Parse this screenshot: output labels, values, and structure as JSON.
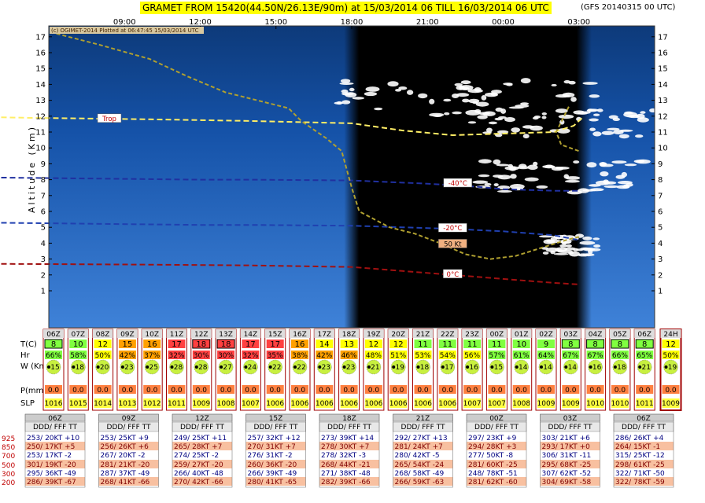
{
  "header": {
    "title": "GRAMET FROM 15420(44.50N/26.13E/90m) at 15/03/2014 06   TILL  16/03/2014 06 UTC",
    "model": "(GFS 20140315 00 UTC)",
    "credit": "(c) OGIMET-2014 Plotted at 06:47:45 15/03/2014 UTC"
  },
  "chart_data": {
    "type": "meteogram",
    "ylabel": "Altitude (Km)",
    "y_ticks": [
      "1",
      "2",
      "3",
      "4",
      "5",
      "6",
      "7",
      "8",
      "9",
      "10",
      "11",
      "12",
      "13",
      "14",
      "15",
      "16",
      "17"
    ],
    "x_ticks": [
      "09:00",
      "12:00",
      "15:00",
      "18:00",
      "21:00",
      "00:00",
      "03:00"
    ],
    "night_shading": {
      "start_hour": 17.7,
      "end_hour": 27.5
    },
    "isotherms": [
      {
        "label": "Trop",
        "color": "#ffee66",
        "points": [
          [
            0,
            12.05
          ],
          [
            5,
            11.9
          ],
          [
            10,
            11.8
          ],
          [
            14,
            11.7
          ],
          [
            18,
            11.55
          ],
          [
            20,
            11.1
          ],
          [
            22,
            10.8
          ],
          [
            23,
            10.85
          ],
          [
            24,
            10.9
          ],
          [
            26,
            11.0
          ],
          [
            26.8,
            11.4
          ],
          [
            27.2,
            12.0
          ]
        ]
      },
      {
        "label": "-40°C",
        "color": "#2030a0",
        "points": [
          [
            0,
            8.2
          ],
          [
            6,
            8.1
          ],
          [
            12,
            8.0
          ],
          [
            14,
            8.0
          ],
          [
            18,
            7.95
          ],
          [
            21,
            7.75
          ],
          [
            23,
            7.55
          ],
          [
            24,
            7.4
          ],
          [
            26,
            7.3
          ],
          [
            27,
            7.3
          ]
        ]
      },
      {
        "label": "-20°C",
        "color": "#2040b0",
        "points": [
          [
            0,
            5.35
          ],
          [
            6,
            5.25
          ],
          [
            12,
            5.15
          ],
          [
            14,
            5.15
          ],
          [
            18,
            5.1
          ],
          [
            20,
            5.0
          ],
          [
            22,
            4.9
          ],
          [
            24,
            4.75
          ],
          [
            26,
            4.5
          ],
          [
            27,
            4.2
          ]
        ]
      },
      {
        "label": "0°C",
        "color": "#a01010",
        "points": [
          [
            0,
            2.75
          ],
          [
            4,
            2.7
          ],
          [
            10,
            2.65
          ],
          [
            14,
            2.6
          ],
          [
            18,
            2.5
          ],
          [
            20,
            2.25
          ],
          [
            22,
            2.0
          ],
          [
            24,
            1.75
          ],
          [
            26,
            1.5
          ],
          [
            27,
            1.4
          ]
        ]
      }
    ],
    "wind_isotach": {
      "label": "50 Kt",
      "color": "#b0a030",
      "points": [
        [
          6.3,
          17.2
        ],
        [
          8,
          16.5
        ],
        [
          10,
          15.6
        ],
        [
          11.5,
          14.5
        ],
        [
          13,
          13.5
        ],
        [
          14.5,
          12.9
        ],
        [
          15.5,
          12.5
        ],
        [
          16,
          11.7
        ],
        [
          17,
          10.6
        ],
        [
          17.6,
          9.8
        ],
        [
          18,
          7.5
        ],
        [
          18.3,
          6.0
        ],
        [
          19.5,
          5.0
        ],
        [
          20.5,
          4.6
        ],
        [
          21.5,
          4.0
        ],
        [
          22.5,
          3.3
        ],
        [
          23.5,
          3.0
        ],
        [
          24.5,
          3.2
        ],
        [
          25.5,
          3.7
        ],
        [
          26.5,
          4.2
        ],
        [
          27,
          4.4
        ]
      ]
    },
    "wind_isotach_upper": {
      "color": "#b0a030",
      "points": [
        [
          26.6,
          12.6
        ],
        [
          26.1,
          11.0
        ],
        [
          26.3,
          10.2
        ],
        [
          27,
          9.8
        ]
      ]
    },
    "surface_table": {
      "row_labels": [
        "T(C)",
        "Hr",
        "W (Kmh)",
        "P(mm)",
        "SLP"
      ],
      "hours": [
        "06Z",
        "07Z",
        "08Z",
        "09Z",
        "10Z",
        "11Z",
        "12Z",
        "13Z",
        "14Z",
        "15Z",
        "16Z",
        "17Z",
        "18Z",
        "19Z",
        "20Z",
        "21Z",
        "22Z",
        "23Z",
        "00Z",
        "01Z",
        "02Z",
        "03Z",
        "04Z",
        "05Z",
        "06Z"
      ],
      "temp": [
        "8",
        "10",
        "12",
        "15",
        "16",
        "17",
        "18",
        "18",
        "17",
        "17",
        "16",
        "14",
        "13",
        "12",
        "12",
        "11",
        "11",
        "11",
        "11",
        "10",
        "9",
        "8",
        "8",
        "8",
        "8"
      ],
      "hr": [
        "66%",
        "58%",
        "50%",
        "42%",
        "37%",
        "32%",
        "30%",
        "30%",
        "32%",
        "35%",
        "38%",
        "42%",
        "46%",
        "48%",
        "51%",
        "53%",
        "54%",
        "56%",
        "57%",
        "61%",
        "64%",
        "67%",
        "67%",
        "66%",
        "65%"
      ],
      "wind": [
        "15",
        "18",
        "20",
        "23",
        "25",
        "28",
        "28",
        "27",
        "24",
        "22",
        "22",
        "23",
        "23",
        "21",
        "19",
        "18",
        "17",
        "16",
        "15",
        "14",
        "14",
        "14",
        "16",
        "18",
        "21"
      ],
      "precip": [
        "0.0",
        "0.0",
        "0.0",
        "0.0",
        "0.0",
        "0.0",
        "0.0",
        "0.0",
        "0.0",
        "0.0",
        "0.0",
        "0.0",
        "0.0",
        "0.0",
        "0.0",
        "0.0",
        "0.0",
        "0.0",
        "0.0",
        "0.0",
        "0.0",
        "0.0",
        "0.0",
        "0.0",
        "0.0"
      ],
      "slp": [
        "1016",
        "1015",
        "1014",
        "1013",
        "1012",
        "1011",
        "1009",
        "1008",
        "1007",
        "1006",
        "1006",
        "1006",
        "1006",
        "1006",
        "1006",
        "1006",
        "1006",
        "1007",
        "1007",
        "1008",
        "1009",
        "1009",
        "1010",
        "1010",
        "1011"
      ],
      "summary": {
        "hours": "24H",
        "temp": "12",
        "hr": "50%",
        "wind": "19",
        "precip": "0.0",
        "slp": "1009"
      }
    },
    "upper_winds": {
      "levels": [
        "925",
        "850",
        "700",
        "500",
        "300",
        "200"
      ],
      "header": "DDD/ FFF TT",
      "blocks": [
        {
          "time": "06Z",
          "rows": [
            "253/ 20KT +10",
            "250/ 17KT +5",
            "253/ 17KT -2",
            "301/ 19KT -20",
            "295/ 36KT -49",
            "286/ 39KT -67"
          ]
        },
        {
          "time": "09Z",
          "rows": [
            "253/ 25KT +9",
            "256/ 26KT +6",
            "267/ 20KT -2",
            "281/ 21KT -20",
            "287/ 37KT -49",
            "268/ 41KT -66"
          ]
        },
        {
          "time": "12Z",
          "rows": [
            "249/ 25KT +11",
            "265/ 28KT +7",
            "274/ 25KT -2",
            "259/ 27KT -20",
            "266/ 40KT -48",
            "270/ 42KT -66"
          ]
        },
        {
          "time": "15Z",
          "rows": [
            "257/ 32KT +12",
            "270/ 31KT +7",
            "276/ 31KT -2",
            "260/ 36KT -20",
            "266/ 39KT -49",
            "280/ 41KT -65"
          ]
        },
        {
          "time": "18Z",
          "rows": [
            "273/ 39KT +14",
            "278/ 30KT +7",
            "278/ 32KT -3",
            "268/ 44KT -21",
            "271/ 38KT -48",
            "282/ 39KT -66"
          ]
        },
        {
          "time": "21Z",
          "rows": [
            "292/ 27KT +13",
            "281/ 24KT +7",
            "280/ 42KT -5",
            "265/ 54KT -24",
            "268/ 58KT -49",
            "266/ 59KT -63"
          ]
        },
        {
          "time": "00Z",
          "rows": [
            "297/ 23KT +9",
            "294/ 28KT +3",
            "277/ 50KT -8",
            "281/ 60KT -25",
            "248/ 78KT -51",
            "281/ 62KT -60"
          ]
        },
        {
          "time": "03Z",
          "rows": [
            "303/ 21KT +6",
            "293/ 17KT +0",
            "306/ 31KT -11",
            "295/ 68KT -25",
            "307/ 62KT -52",
            "304/ 69KT -58"
          ]
        },
        {
          "time": "06Z",
          "rows": [
            "286/ 26KT +4",
            "264/ 15KT -1",
            "315/ 25KT -12",
            "298/ 61KT -25",
            "322/ 71KT -50",
            "322/ 78KT -59"
          ]
        }
      ]
    }
  }
}
